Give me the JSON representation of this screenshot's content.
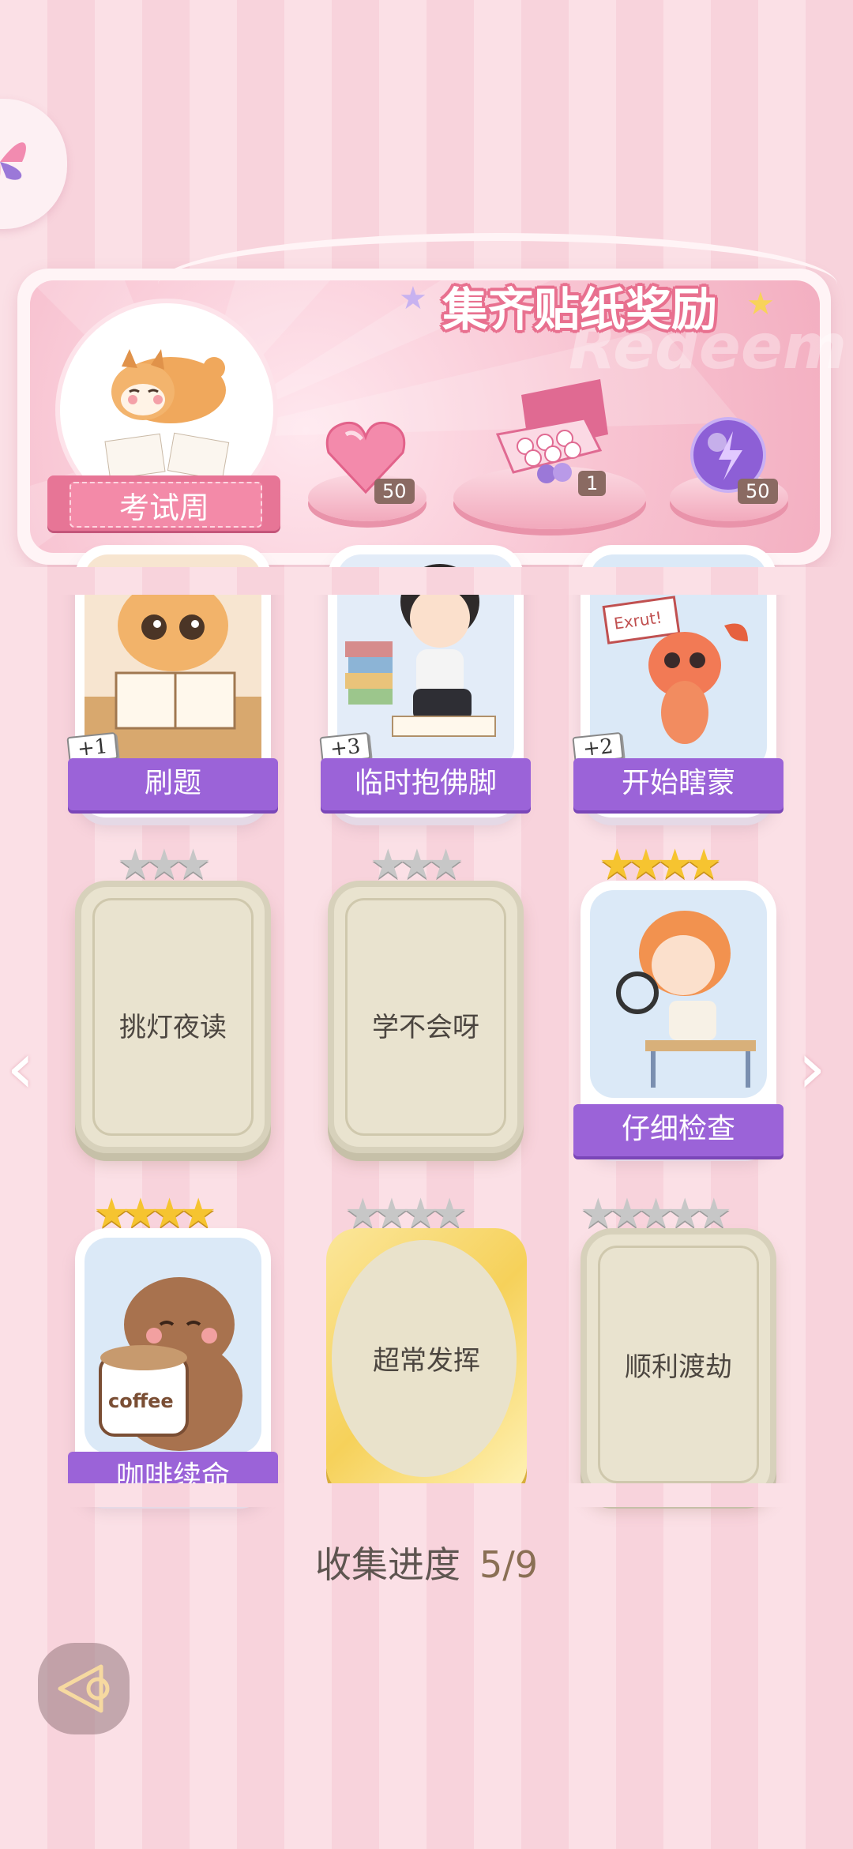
{
  "banner": {
    "title": "集齐贴纸奖励",
    "watermark": "Redeem"
  },
  "badge": {
    "label": "考试周"
  },
  "rewards": [
    {
      "name": "heart-gem",
      "count": "50"
    },
    {
      "name": "gift-box",
      "count": "1"
    },
    {
      "name": "energy-orb",
      "count": "50"
    }
  ],
  "cards": [
    {
      "label": "刷题",
      "plus": "+1",
      "owned": true
    },
    {
      "label": "临时抱佛脚",
      "plus": "+3",
      "owned": true
    },
    {
      "label": "开始瞎蒙",
      "plus": "+2",
      "owned": true
    },
    {
      "label": "挑灯夜读",
      "stars": 3,
      "stars_filled": 0,
      "owned": false
    },
    {
      "label": "学不会呀",
      "stars": 3,
      "stars_filled": 0,
      "owned": false
    },
    {
      "label": "仔细检查",
      "stars": 4,
      "stars_filled": 4,
      "owned": true
    },
    {
      "label": "咖啡续命",
      "stars": 4,
      "stars_filled": 4,
      "owned": true,
      "art_text": "coffee"
    },
    {
      "label": "超常发挥",
      "stars": 4,
      "stars_filled": 0,
      "owned": false
    },
    {
      "label": "顺利渡劫",
      "stars": 5,
      "stars_filled": 0,
      "owned": false
    }
  ],
  "shrimp_sign": "Exrut!",
  "progress": {
    "label": "收集进度",
    "value": "5/9"
  },
  "colors": {
    "label_purple": "#9b63d8",
    "banner_pink": "#f3afc1",
    "gold_star": "#f6c430"
  }
}
